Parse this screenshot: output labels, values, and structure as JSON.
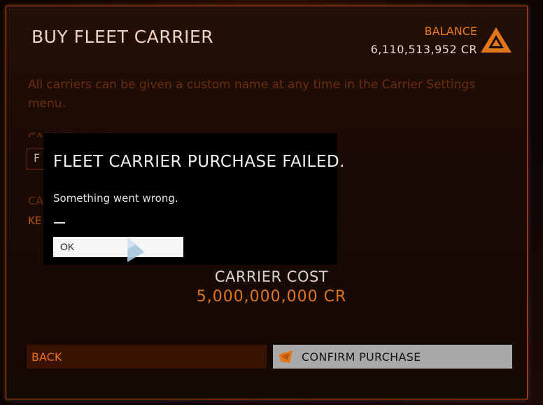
{
  "page": {
    "title": "BUY FLEET CARRIER",
    "balance_label": "BALANCE",
    "balance_value": "6,110,513,952 CR",
    "info_text": "All carriers can be given a custom name at any time in the Carrier Settings menu.",
    "faded": {
      "carrier_name_label": "CARRIER NAME",
      "name_box_letter": "F",
      "second_label": "CA",
      "key_text": "KE"
    }
  },
  "dialog": {
    "title": "FLEET CARRIER PURCHASE FAILED.",
    "message": "Something went wrong.",
    "ok_label": "OK"
  },
  "cost": {
    "label": "CARRIER COST",
    "value": "5,000,000,000 CR"
  },
  "footer": {
    "back_label": "BACK",
    "confirm_label": "CONFIRM PURCHASE"
  },
  "colors": {
    "accent_orange": "#e2761b",
    "panel_border": "#c05010",
    "dialog_bg": "#000000",
    "confirm_bg": "#a9a9a9"
  },
  "icons": {
    "logo": "triangle-emblem-icon",
    "confirm": "carrier-icon",
    "cursor": "pointer-cursor-icon"
  }
}
